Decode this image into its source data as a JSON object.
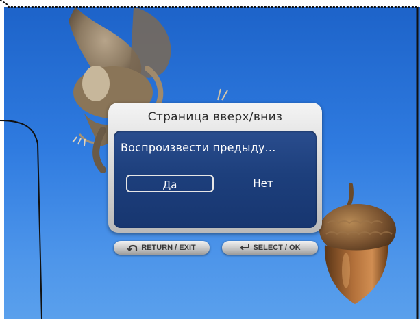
{
  "dialog": {
    "title": "Страница вверх/вниз",
    "message": "Воспроизвести предыду...",
    "options": {
      "yes": "Да",
      "no": "Нет"
    },
    "selected_option": "yes"
  },
  "remote_hints": {
    "return_exit": "RETURN / EXIT",
    "select_ok": "SELECT / OK"
  },
  "icons": {
    "return": "return-arrow-icon",
    "enter": "enter-arrow-icon"
  },
  "colors": {
    "sky_blue": "#2f7be0",
    "dialog_panel": "#1d3f7c",
    "dialog_frame": "#d8d8d8",
    "selection_border": "#e6e6e6"
  }
}
